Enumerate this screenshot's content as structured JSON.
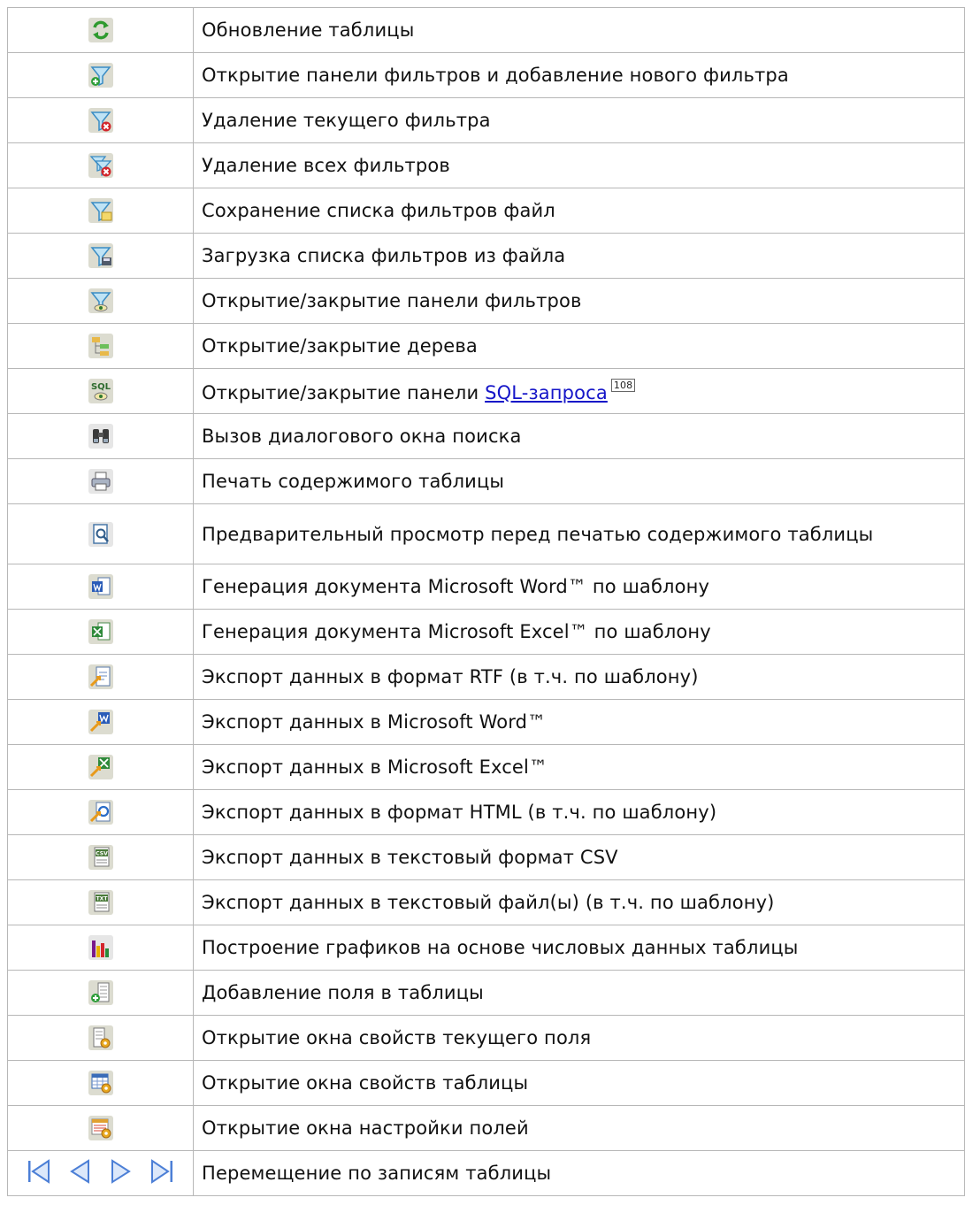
{
  "rows": [
    {
      "icon": "refresh-table-icon",
      "text": "Обновление таблицы"
    },
    {
      "icon": "add-filter-icon",
      "text": "Открытие панели фильтров и добавление нового фильтра"
    },
    {
      "icon": "delete-filter-icon",
      "text": "Удаление текущего фильтра"
    },
    {
      "icon": "delete-all-filters-icon",
      "text": "Удаление всех фильтров"
    },
    {
      "icon": "save-filters-icon",
      "text": "Сохранение списка фильтров файл"
    },
    {
      "icon": "load-filters-icon",
      "text": "Загрузка списка фильтров из файла"
    },
    {
      "icon": "toggle-filter-panel-icon",
      "text": "Открытие/закрытие панели фильтров"
    },
    {
      "icon": "toggle-tree-icon",
      "text": "Открытие/закрытие дерева"
    },
    {
      "icon": "sql-panel-icon",
      "text": "Открытие/закрытие панели ",
      "link": "SQL-запроса",
      "ref": "108",
      "icon_label": "SQL"
    },
    {
      "icon": "binoculars-search-icon",
      "text": "Вызов диалогового окна поиска"
    },
    {
      "icon": "printer-icon",
      "text": "Печать содержимого таблицы"
    },
    {
      "icon": "print-preview-icon",
      "text": "Предварительный просмотр перед печатью содержимого таблицы"
    },
    {
      "icon": "word-template-icon",
      "text": "Генерация документа Microsoft Word™ по шаблону"
    },
    {
      "icon": "excel-template-icon",
      "text": "Генерация документа Microsoft Excel™ по шаблону"
    },
    {
      "icon": "export-rtf-icon",
      "text": "Экспорт данных в формат RTF (в т.ч. по шаблону)"
    },
    {
      "icon": "export-word-icon",
      "text": "Экспорт данных в Microsoft Word™"
    },
    {
      "icon": "export-excel-icon",
      "text": "Экспорт данных в Microsoft Excel™"
    },
    {
      "icon": "export-html-icon",
      "text": "Экспорт данных в формат HTML (в т.ч. по шаблону)"
    },
    {
      "icon": "export-csv-icon",
      "text": "Экспорт данных в текстовый формат CSV",
      "icon_label": "CSV"
    },
    {
      "icon": "export-txt-icon",
      "text": "Экспорт данных в текстовый файл(ы) (в т.ч. по шаблону)",
      "icon_label": "TXT"
    },
    {
      "icon": "chart-icon",
      "text": "Построение графиков на основе числовых данных таблицы"
    },
    {
      "icon": "add-field-icon",
      "text": "Добавление поля в таблицы"
    },
    {
      "icon": "field-properties-icon",
      "text": "Открытие окна свойств текущего поля"
    },
    {
      "icon": "table-properties-icon",
      "text": "Открытие окна свойств таблицы"
    },
    {
      "icon": "field-settings-icon",
      "text": "Открытие окна настройки полей"
    },
    {
      "icon": "record-navigation-icons",
      "text": "Перемещение по записям таблицы"
    }
  ],
  "colors": {
    "border": "#b7b7b7",
    "link": "#1515c8",
    "icon_bg": "#dcdcd0",
    "nav_blue": "#4c7fd6"
  }
}
